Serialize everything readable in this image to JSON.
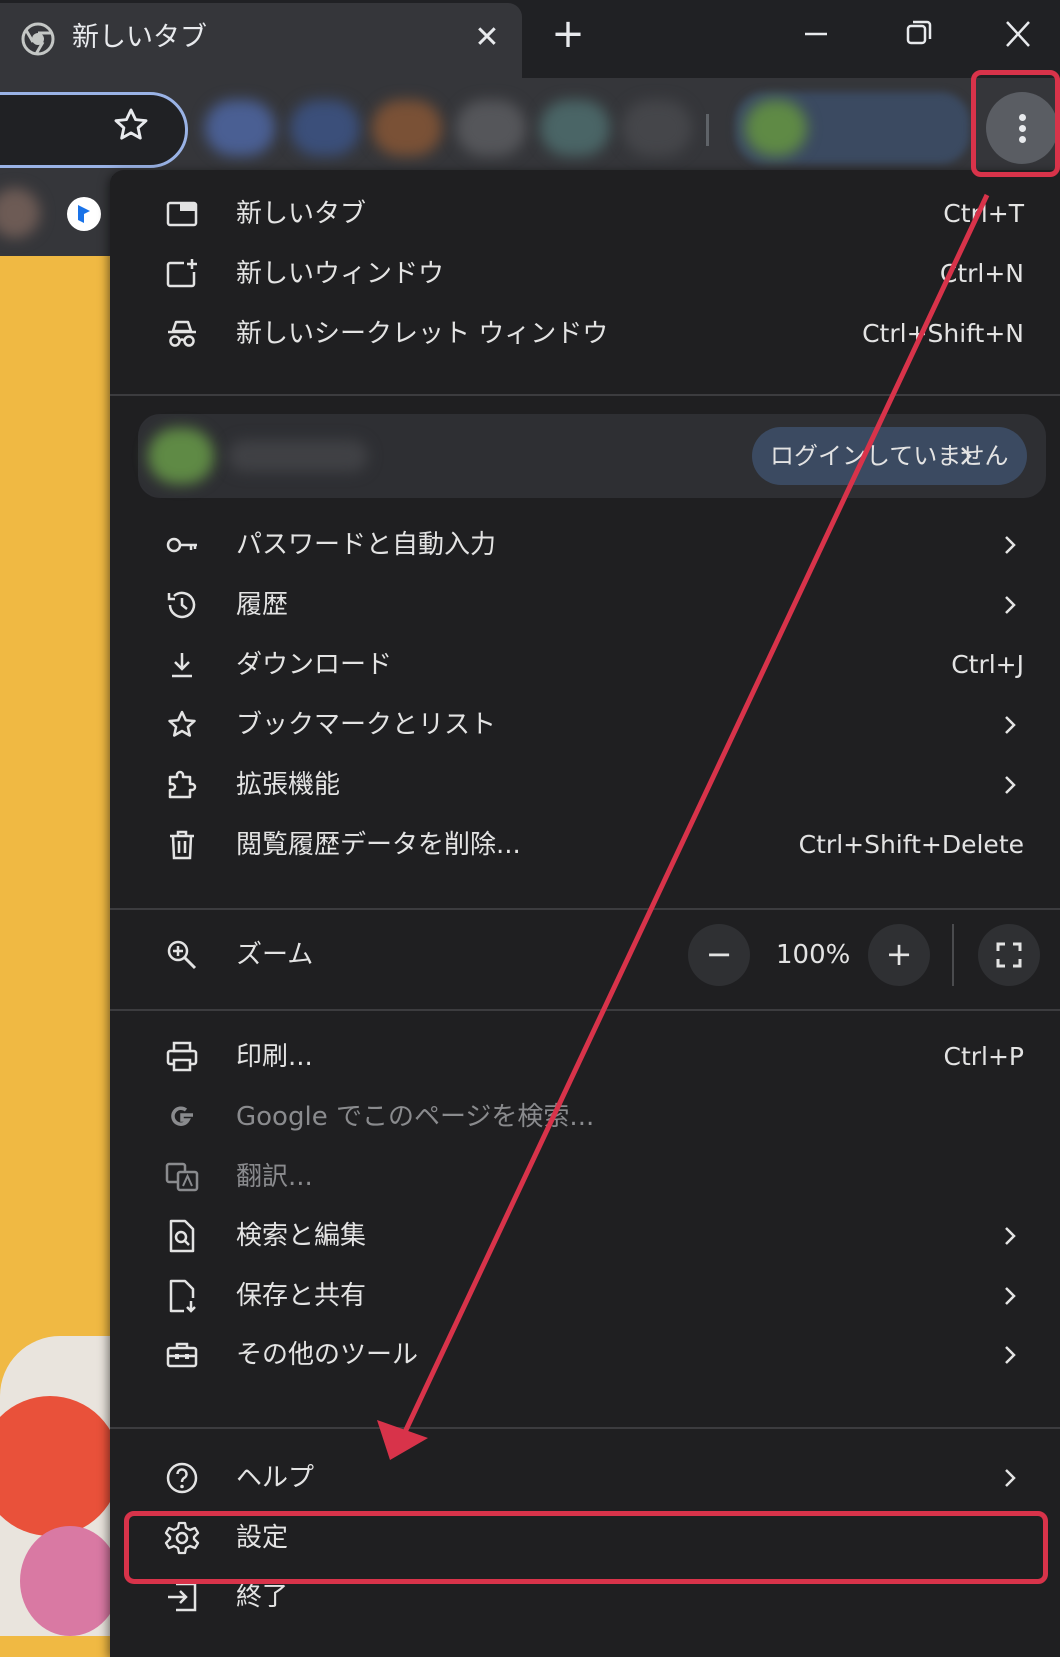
{
  "tab": {
    "title": "新しいタブ",
    "close": "✕",
    "new_tab": "+"
  },
  "menu": {
    "items": [
      {
        "label": "新しいタブ",
        "shortcut": "Ctrl+T"
      },
      {
        "label": "新しいウィンドウ",
        "shortcut": "Ctrl+N"
      },
      {
        "label": "新しいシークレット ウィンドウ",
        "shortcut": "Ctrl+Shift+N"
      },
      {
        "label": "パスワードと自動入力"
      },
      {
        "label": "履歴"
      },
      {
        "label": "ダウンロード",
        "shortcut": "Ctrl+J"
      },
      {
        "label": "ブックマークとリスト"
      },
      {
        "label": "拡張機能"
      },
      {
        "label": "閲覧履歴データを削除...",
        "shortcut": "Ctrl+Shift+Delete"
      },
      {
        "label": "ズーム"
      },
      {
        "label": "印刷...",
        "shortcut": "Ctrl+P"
      },
      {
        "label": "Google でこのページを検索..."
      },
      {
        "label": "翻訳..."
      },
      {
        "label": "検索と編集"
      },
      {
        "label": "保存と共有"
      },
      {
        "label": "その他のツール"
      },
      {
        "label": "ヘルプ"
      },
      {
        "label": "設定"
      },
      {
        "label": "終了"
      }
    ],
    "profile_status": "ログインしていません",
    "zoom_level": "100%",
    "zoom_minus": "−",
    "zoom_plus": "+"
  },
  "colors": {
    "highlight": "#d8334a",
    "menu_bg": "#1f1f21",
    "page_bg": "#f0b943"
  }
}
